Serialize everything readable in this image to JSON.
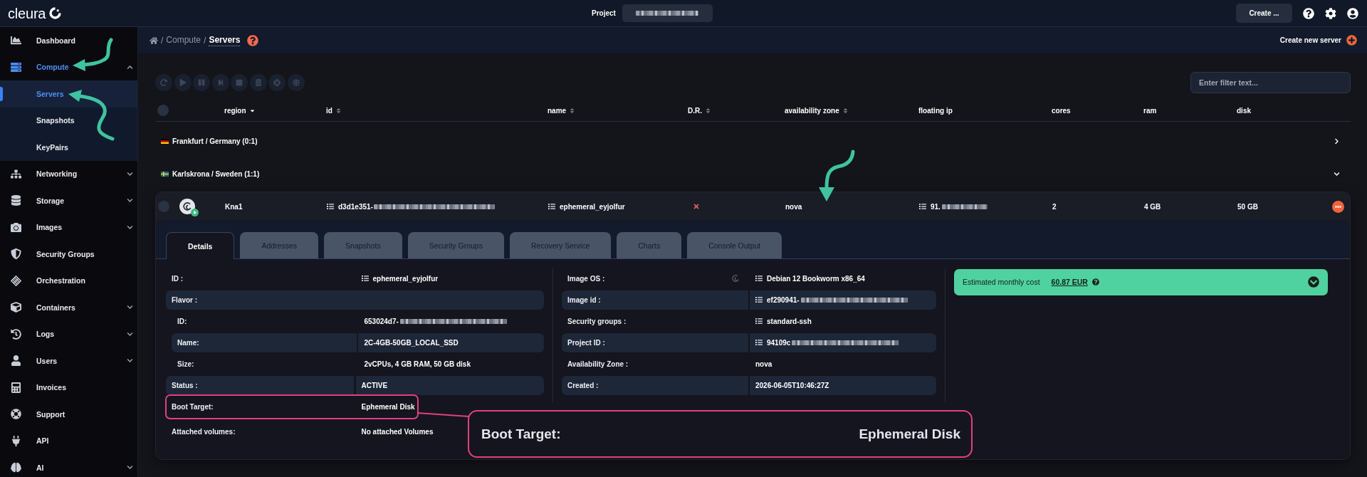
{
  "topbar": {
    "logo": "cleura",
    "project": {
      "label": "Project",
      "redacted": true
    },
    "create_button": "Create ..."
  },
  "sidebar": {
    "items": [
      {
        "label": "Dashboard",
        "kind": "link",
        "selected": false
      },
      {
        "label": "Compute",
        "kind": "group",
        "selected": true,
        "expanded": true,
        "children": [
          {
            "label": "Servers",
            "selected": true
          },
          {
            "label": "Snapshots",
            "selected": false
          },
          {
            "label": "KeyPairs",
            "selected": false
          }
        ]
      },
      {
        "label": "Networking",
        "kind": "group",
        "selected": false,
        "expanded": false
      },
      {
        "label": "Storage",
        "kind": "group",
        "selected": false,
        "expanded": false
      },
      {
        "label": "Images",
        "kind": "group",
        "selected": false,
        "expanded": false
      },
      {
        "label": "Security Groups",
        "kind": "link",
        "selected": false
      },
      {
        "label": "Orchestration",
        "kind": "link",
        "selected": false
      },
      {
        "label": "Containers",
        "kind": "group",
        "selected": false,
        "expanded": false
      },
      {
        "label": "Logs",
        "kind": "group",
        "selected": false,
        "expanded": false
      },
      {
        "label": "Users",
        "kind": "group",
        "selected": false,
        "expanded": false
      },
      {
        "label": "Invoices",
        "kind": "link",
        "selected": false
      },
      {
        "label": "Support",
        "kind": "link",
        "selected": false
      },
      {
        "label": "API",
        "kind": "link",
        "selected": false
      },
      {
        "label": "AI",
        "kind": "group",
        "selected": false,
        "expanded": false
      }
    ]
  },
  "breadcrumb": {
    "separator": "/",
    "crumbs": [
      {
        "label": "Compute",
        "current": false
      },
      {
        "label": "Servers",
        "current": true
      }
    ]
  },
  "create_server": "Create new server",
  "toolbar": {
    "actions": [
      {
        "disabled": true
      },
      {
        "disabled": true
      },
      {
        "disabled": true
      },
      {
        "disabled": true
      },
      {
        "disabled": true
      },
      {
        "disabled": true
      },
      {
        "disabled": true
      },
      {
        "disabled": true
      }
    ]
  },
  "filter": {
    "placeholder": "Enter filter text..."
  },
  "table": {
    "all_selected": false,
    "columns": [
      {
        "label": "region",
        "sortable": true,
        "sorted": true
      },
      {
        "label": "id",
        "sortable": true,
        "sorted": false
      },
      {
        "label": "name",
        "sortable": true,
        "sorted": false
      },
      {
        "label": "D.R.",
        "sortable": true,
        "sorted": false
      },
      {
        "label": "availability zone",
        "sortable": true,
        "sorted": false
      },
      {
        "label": "floating ip",
        "sortable": false,
        "sorted": false
      },
      {
        "label": "cores",
        "sortable": false,
        "sorted": false
      },
      {
        "label": "ram",
        "sortable": false,
        "sorted": false
      },
      {
        "label": "disk",
        "sortable": false,
        "sorted": false
      }
    ],
    "groups": [
      {
        "label": "Frankfurt / Germany (0:1)",
        "expanded": false
      },
      {
        "label": "Karlskrona / Sweden (1:1)",
        "expanded": true,
        "servers": [
          {
            "selected": false,
            "running": true,
            "expanded": true,
            "region": "Kna1",
            "id": {
              "value": "d3d1e351-",
              "redacted": true
            },
            "name": "ephemeral_eyjolfur",
            "dr_enabled": false,
            "availability_zone": "nova",
            "floating_ip": {
              "value": "91.",
              "redacted": true
            },
            "cores": "2",
            "ram": "4 GB",
            "disk": "50 GB",
            "details": {
              "tabs": [
                {
                  "label": "Details",
                  "selected": true
                },
                {
                  "label": "Addresses",
                  "selected": false
                },
                {
                  "label": "Snapshots",
                  "selected": false
                },
                {
                  "label": "Security Groups",
                  "selected": false
                },
                {
                  "label": "Recovery Service",
                  "selected": false
                },
                {
                  "label": "Charts",
                  "selected": false
                },
                {
                  "label": "Console Output",
                  "selected": false
                }
              ],
              "fields": [
                {
                  "label": "ID :",
                  "value": "ephemeral_eyjolfur",
                  "linked": true
                },
                {
                  "label": "Flavor :",
                  "children": [
                    {
                      "label": "ID:",
                      "value": "653024d7-",
                      "redacted": true
                    },
                    {
                      "label": "Name:",
                      "value": "2C-4GB-50GB_LOCAL_SSD"
                    },
                    {
                      "label": "Size:",
                      "value": "2vCPUs, 4 GB RAM, 50 GB disk"
                    }
                  ]
                },
                {
                  "label": "Status :",
                  "value": "ACTIVE"
                },
                {
                  "label": "Boot Target:",
                  "value": "Ephemeral Disk",
                  "highlighted": true
                }
              ],
              "volumes": {
                "label": "Attached volumes:",
                "value": "No attached Volumes"
              },
              "image_fields": [
                {
                  "label": "Image OS :",
                  "value": "Debian 12 Bookworm x86_64",
                  "linked": true
                },
                {
                  "label": "Image id :",
                  "value": "ef290941-",
                  "linked": true,
                  "redacted": true
                },
                {
                  "label": "Security groups :",
                  "value": "standard-ssh",
                  "linked": true
                },
                {
                  "label": "Project ID :",
                  "value": "94109c",
                  "linked": true,
                  "redacted": true
                },
                {
                  "label": "Availability Zone :",
                  "value": "nova"
                },
                {
                  "label": "Created :",
                  "value": "2026-06-05T10:46:27Z"
                }
              ],
              "cost": {
                "label": "Estimated monthly cost",
                "amount": "60.87 EUR",
                "expanded": false
              }
            }
          }
        ]
      }
    ]
  },
  "callout": {
    "label": "Boot Target:",
    "value": "Ephemeral Disk"
  }
}
